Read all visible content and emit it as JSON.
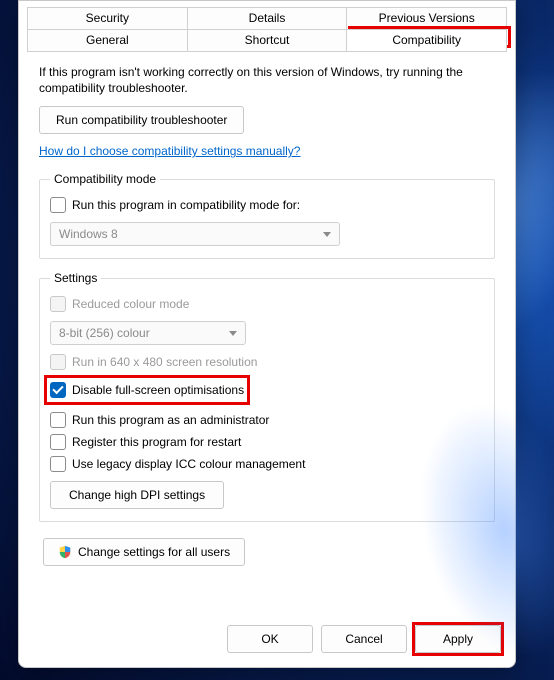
{
  "tabs": {
    "row1": [
      "Security",
      "Details",
      "Previous Versions"
    ],
    "row2": [
      "General",
      "Shortcut",
      "Compatibility"
    ],
    "active": "Compatibility"
  },
  "intro": "If this program isn't working correctly on this version of Windows, try running the compatibility troubleshooter.",
  "run_troubleshooter": "Run compatibility troubleshooter",
  "help_link": "How do I choose compatibility settings manually?",
  "compat_mode": {
    "legend": "Compatibility mode",
    "checkbox": "Run this program in compatibility mode for:",
    "select_value": "Windows 8"
  },
  "settings": {
    "legend": "Settings",
    "reduced_colour": "Reduced colour mode",
    "colour_select": "8-bit (256) colour",
    "run_640": "Run in 640 x 480 screen resolution",
    "disable_fs": "Disable full-screen optimisations",
    "run_admin": "Run this program as an administrator",
    "register_restart": "Register this program for restart",
    "legacy_icc": "Use legacy display ICC colour management",
    "change_dpi": "Change high DPI settings"
  },
  "change_all_users": "Change settings for all users",
  "footer": {
    "ok": "OK",
    "cancel": "Cancel",
    "apply": "Apply"
  }
}
